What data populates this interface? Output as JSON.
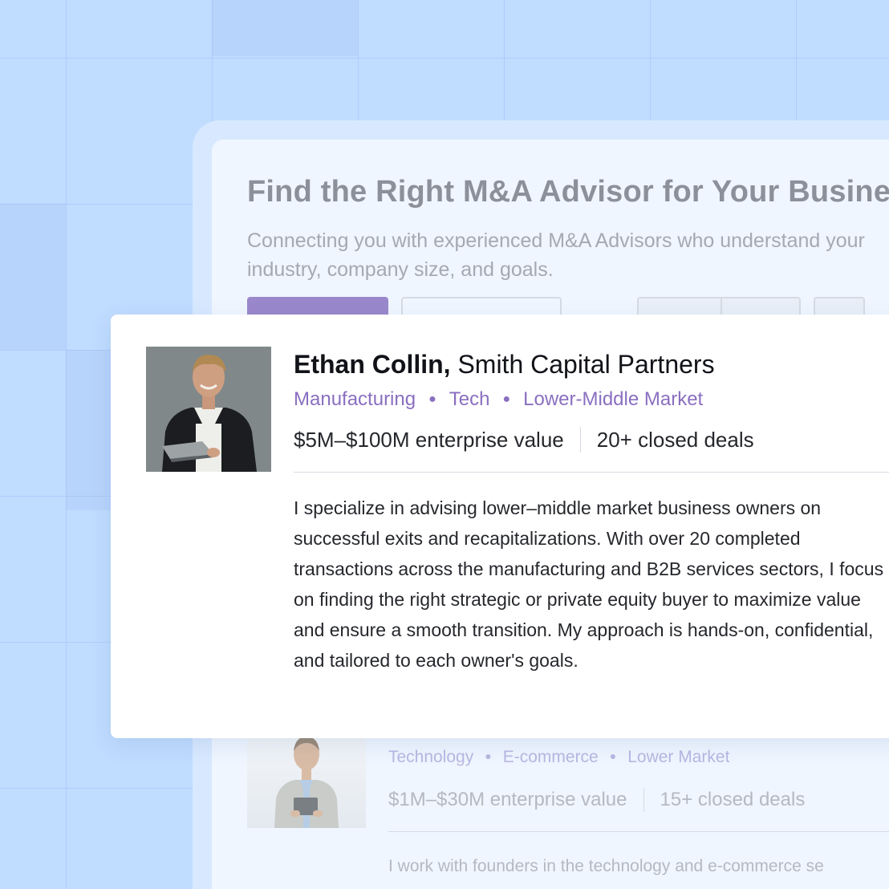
{
  "page": {
    "title": "Find the Right M&A Advisor for Your Business",
    "subtitle": "Connecting you with experienced M&A Advisors who understand your industry, company size, and goals."
  },
  "featured_advisor": {
    "name": "Ethan Collin,",
    "firm": "Smith Capital Partners",
    "tags": [
      "Manufacturing",
      "Tech",
      "Lower-Middle Market"
    ],
    "enterprise_value": "$5M–$100M enterprise value",
    "closed_deals": "20+ closed deals",
    "bio": "I specialize in advising lower–middle market business owners on successful exits and recapitalizations. With over 20 completed transactions across the manufacturing and B2B services sectors, I focus on finding the right strategic or private equity buyer to maximize value and ensure a smooth transition. My approach is hands-on, confidential, and tailored to each owner's goals."
  },
  "second_advisor": {
    "tags": [
      "Technology",
      "E-commerce",
      "Lower Market"
    ],
    "enterprise_value": "$1M–$30M enterprise value",
    "closed_deals": "15+ closed deals",
    "bio": "I work with founders in the technology and e-commerce se"
  },
  "colors": {
    "background": "#c0dcff",
    "accent": "#8a6fc0",
    "primary_button": "#9a88cc"
  }
}
